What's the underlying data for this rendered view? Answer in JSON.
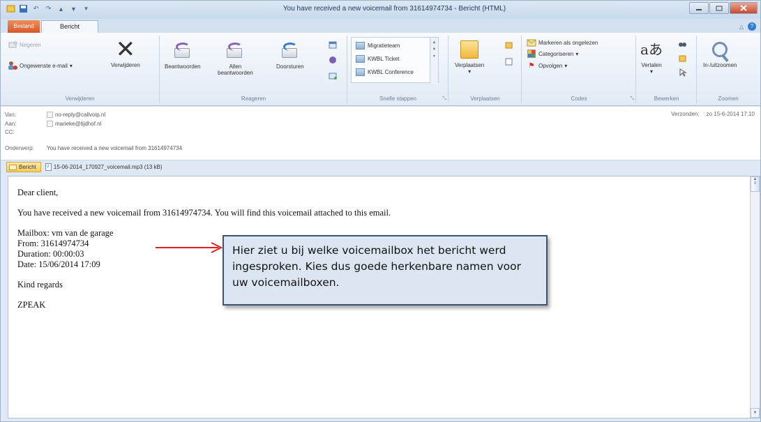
{
  "window": {
    "title": "You have received a new voicemail from 31614974734  -  Bericht (HTML)"
  },
  "tabs": {
    "file": "Bestand",
    "message": "Bericht"
  },
  "ribbon": {
    "delete_group": {
      "label": "Verwijderen",
      "ignore": "Negeren",
      "junk": "Ongewenste e-mail",
      "delete": "Verwijderen"
    },
    "respond_group": {
      "label": "Reageren",
      "reply": "Beantwoorden",
      "reply_all_line1": "Allen",
      "reply_all_line2": "beantwoorden",
      "forward": "Doorsturen"
    },
    "quick_steps_group": {
      "label": "Snelle stappen",
      "items": [
        "Migratieteam",
        "KWBL Ticket",
        "KWBL Conference"
      ]
    },
    "move_group": {
      "label": "Verplaatsen",
      "move": "Verplaatsen"
    },
    "tags_group": {
      "label": "Codes",
      "mark_unread": "Markeren als ongelezen",
      "categorize": "Categoriseren",
      "follow_up": "Opvolgen"
    },
    "edit_group": {
      "label": "Bewerken",
      "translate": "Vertalen"
    },
    "zoom_group": {
      "label": "Zoomen",
      "zoom": "In-/uitzoomen"
    }
  },
  "headers": {
    "from_label": "Van:",
    "from_value": "no-reply@callvoip.nl",
    "to_label": "Aan:",
    "to_value": "marieke@tijdhof.nl",
    "cc_label": "CC:",
    "subject_label": "Onderwerp:",
    "subject_value": "You have received a new voicemail from 31614974734",
    "sent_label": "Verzonden:",
    "sent_value": "zo 15-6-2014 17:10"
  },
  "attachments": {
    "message_tab": "Bericht",
    "file": "15-06-2014_170927_voicemail.mp3 (13 kB)"
  },
  "body": {
    "greeting": "Dear client,",
    "intro": "You have received a new voicemail from 31614974734. You will find this voicemail attached to this email.",
    "mailbox": "Mailbox: vm van de garage",
    "from": "From: 31614974734",
    "duration": "Duration: 00:00:03",
    "date": "Date: 15/06/2014 17:09",
    "regards": "Kind regards",
    "signature": "ZPEAK"
  },
  "callout": {
    "text": "Hier ziet u bij welke voicemailbox het bericht werd ingesproken. Kies dus goede herkenbare namen voor uw voicemailboxen.",
    "border_color": "#3b5472",
    "fill_color": "#dce6f2",
    "arrow_color": "#e02020"
  }
}
